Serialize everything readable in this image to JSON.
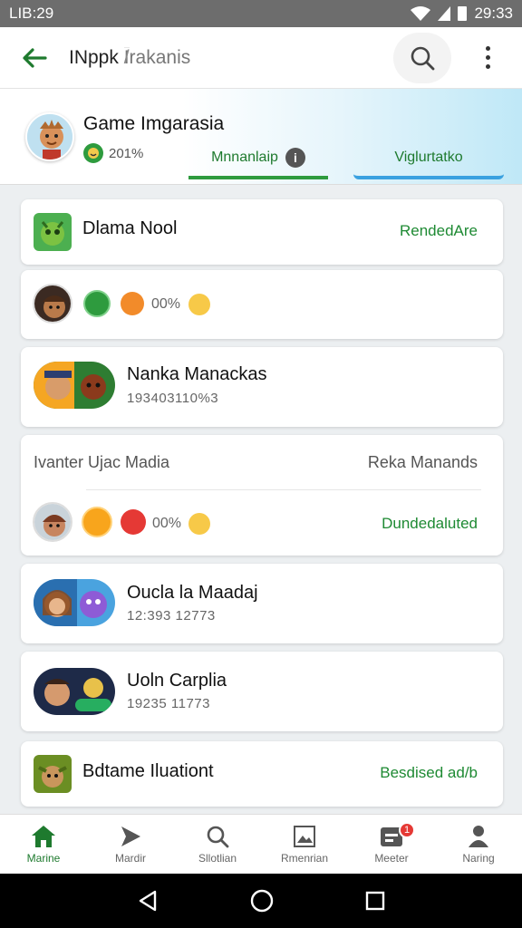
{
  "status_bar": {
    "time_left": "LIB:29",
    "time_right": "29:33"
  },
  "app_bar": {
    "title": "INppk",
    "separator": "/",
    "subtitle": "Irakanis"
  },
  "profile": {
    "name": "Game Imgarasia",
    "stat": "201%",
    "tab_primary": "Mnnanlaip",
    "tab_secondary": "Viglurtatko"
  },
  "card1": {
    "row1": {
      "title": "Dlama Nool",
      "action": "RendedAre"
    },
    "row2": {
      "percent": "00%"
    },
    "row3": {
      "title": "Nanka Manackas",
      "number": "193403110%3"
    }
  },
  "card2": {
    "header_left": "Ivanter Ujac Madia",
    "header_right": "Reka Manands",
    "row1": {
      "percent": "00%",
      "action": "Dundedaluted"
    }
  },
  "card3": {
    "title": "Oucla la Maadaj",
    "number": "12:393 12773"
  },
  "card4": {
    "title": "Uoln Carplia",
    "number": "19235 11773"
  },
  "card5": {
    "title": "Bdtame Iluationt",
    "action": "Besdised ad/b"
  },
  "bottom_nav": [
    {
      "label": "Marine",
      "icon": "home-icon"
    },
    {
      "label": "Mardir",
      "icon": "play-icon"
    },
    {
      "label": "Sllotlian",
      "icon": "search-icon"
    },
    {
      "label": "Rmenrian",
      "icon": "image-icon"
    },
    {
      "label": "Meeter",
      "icon": "inbox-icon",
      "badge": "1"
    },
    {
      "label": "Naring",
      "icon": "person-icon"
    }
  ],
  "colors": {
    "accent_green": "#1e8a33",
    "accent_blue": "#3aa1e0",
    "badge_red": "#e53935"
  }
}
